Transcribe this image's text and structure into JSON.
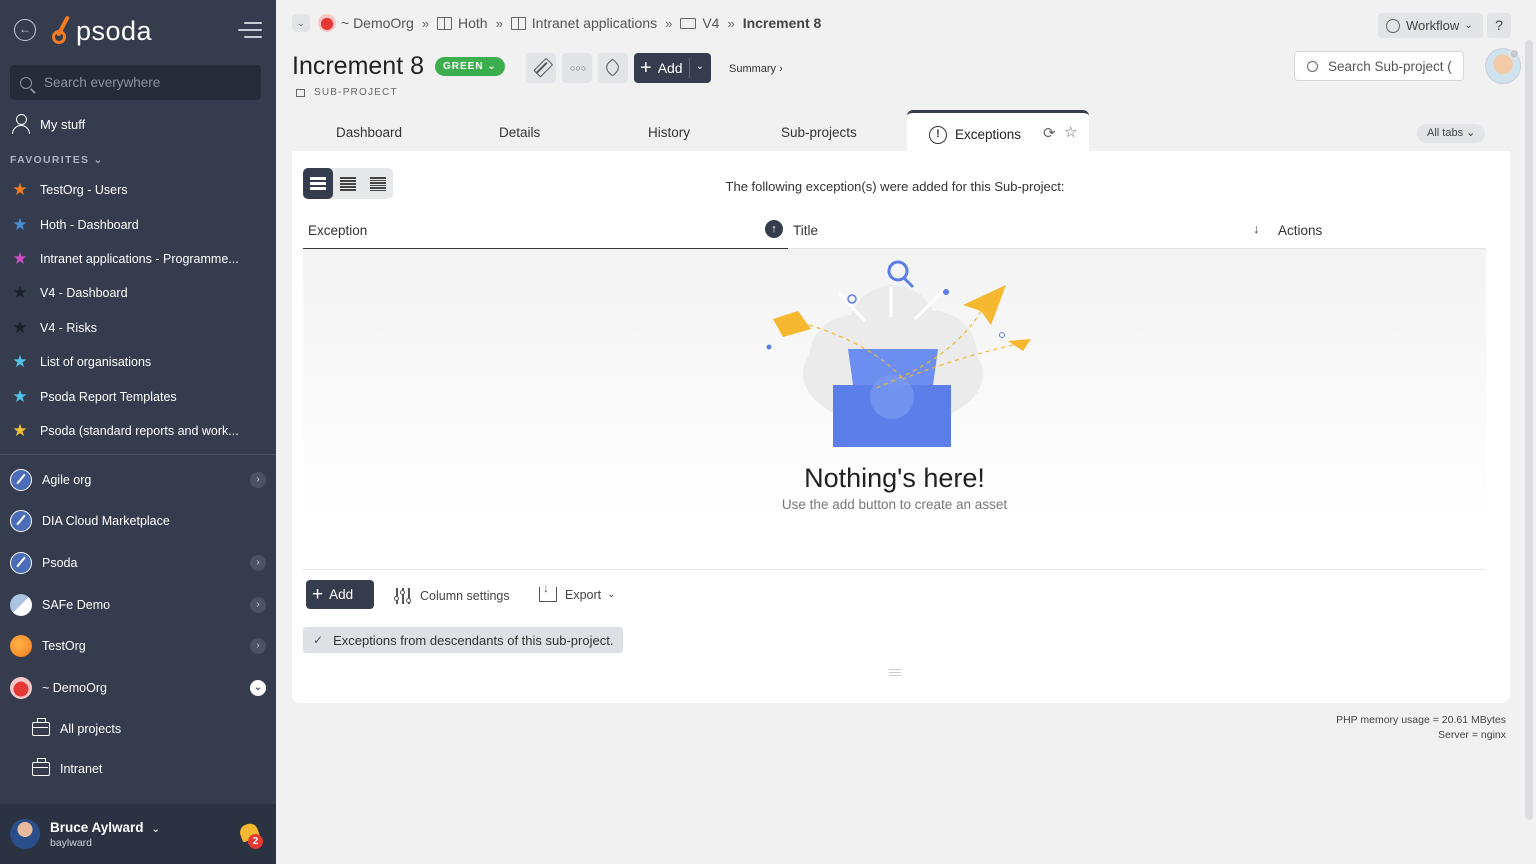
{
  "sidebar": {
    "logo_text": "psoda",
    "search_placeholder": "Search everywhere",
    "my_stuff": "My stuff",
    "favourites_heading": "FAVOURITES",
    "favourites": [
      {
        "label": "TestOrg - Users",
        "color": "#f47b20"
      },
      {
        "label": "Hoth - Dashboard",
        "color": "#4a90d9"
      },
      {
        "label": "Intranet applications - Programme...",
        "color": "#c94fc8"
      },
      {
        "label": "V4 - Dashboard",
        "color": "#222222"
      },
      {
        "label": "V4 - Risks",
        "color": "#222222"
      },
      {
        "label": "List of organisations",
        "color": "#4fc3e8"
      },
      {
        "label": "Psoda Report Templates",
        "color": "#4fc3e8"
      },
      {
        "label": "Psoda (standard reports and work...",
        "color": "#f5c031"
      }
    ],
    "organisations": [
      {
        "label": "Agile org",
        "icon": "rocket",
        "expandable": true
      },
      {
        "label": "DIA Cloud Marketplace",
        "icon": "rocket",
        "expandable": false
      },
      {
        "label": "Psoda",
        "icon": "rocket",
        "expandable": true
      },
      {
        "label": "SAFe Demo",
        "icon": "safe",
        "expandable": true
      },
      {
        "label": "TestOrg",
        "icon": "testorg",
        "expandable": true
      },
      {
        "label": "~ DemoOrg",
        "icon": "demo",
        "expandable": true,
        "open": true
      }
    ],
    "demoorg_children": [
      "All projects",
      "Intranet"
    ],
    "user": {
      "name": "Bruce Aylward",
      "handle": "baylward",
      "notifications": "2"
    }
  },
  "breadcrumbs": [
    "~ DemoOrg",
    "Hoth",
    "Intranet applications",
    "V4",
    "Increment 8"
  ],
  "header": {
    "workflow_label": "Workflow",
    "help_label": "?",
    "title": "Increment 8",
    "status": "GREEN",
    "status_color": "#3dae4e",
    "type_label": "SUB-PROJECT",
    "add_label": "Add",
    "summary_label": "Summary ›",
    "search_placeholder": "Search Sub-project ("
  },
  "tabs": {
    "items": [
      "Dashboard",
      "Details",
      "History",
      "Sub-projects"
    ],
    "active": "Exceptions",
    "all_tabs": "All tabs"
  },
  "panel": {
    "intro": "The following exception(s) were added for this Sub-project:",
    "columns": {
      "exception": "Exception",
      "title": "Title",
      "actions": "Actions"
    },
    "empty_title": "Nothing's here!",
    "empty_sub": "Use the add button to create an asset",
    "add_label": "Add",
    "column_settings": "Column settings",
    "export": "Export",
    "descendants": "Exceptions from descendants of this sub-project."
  },
  "server": {
    "memory": "PHP memory usage = 20.61 MBytes",
    "server": "Server = nginx"
  }
}
